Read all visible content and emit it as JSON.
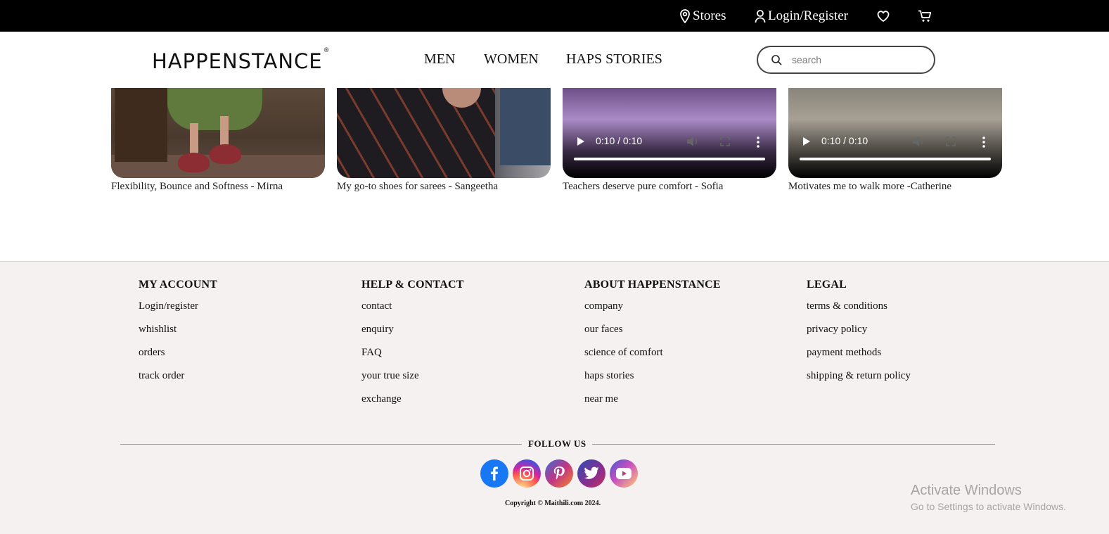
{
  "topbar": {
    "stores_label": "Stores",
    "login_label": "Login/Register",
    "stores_icon": "location-pin-icon",
    "login_icon": "user-icon",
    "wishlist_icon": "heart-icon",
    "cart_icon": "cart-icon"
  },
  "header": {
    "logo": "HAPPENSTANCE",
    "logo_mark": "®",
    "nav": [
      "MEN",
      "WOMEN",
      "HAPS STORIES"
    ],
    "search_placeholder": "search"
  },
  "videos": [
    {
      "caption": "Flexibility, Bounce and Softness - Mirna",
      "has_controls": false
    },
    {
      "caption": "My go-to shoes for sarees - Sangeetha",
      "has_controls": false
    },
    {
      "caption": "Teachers deserve pure comfort - Sofia",
      "time": "0:10 / 0:10",
      "progress": 1.0
    },
    {
      "caption": "Motivates me to walk more -Catherine",
      "time": "0:10 / 0:10",
      "progress": 1.0
    }
  ],
  "footer": {
    "columns": [
      {
        "heading": "MY ACCOUNT",
        "links": [
          "Login/register",
          "whishlist",
          "orders",
          "track order"
        ]
      },
      {
        "heading": "HELP & CONTACT",
        "links": [
          "contact",
          "enquiry",
          "FAQ",
          "your true size",
          "exchange"
        ]
      },
      {
        "heading": "ABOUT HAPPENSTANCE",
        "links": [
          "company",
          "our faces",
          "science of comfort",
          "haps stories",
          "near me"
        ]
      },
      {
        "heading": "LEGAL",
        "links": [
          "terms & conditions",
          "privacy policy",
          "payment methods",
          "shipping & return policy"
        ]
      }
    ],
    "follow_label": "FOLLOW US",
    "social": [
      "facebook-icon",
      "instagram-icon",
      "pinterest-icon",
      "twitter-icon",
      "youtube-icon"
    ],
    "copyright": "Copyright © Maithili.com 2024."
  },
  "windows_watermark": {
    "title": "Activate Windows",
    "subtitle": "Go to Settings to activate Windows."
  },
  "colors": {
    "topbar_bg": "#000000",
    "footer_bg": "#f5f1f0",
    "facebook": "#1877f2"
  }
}
